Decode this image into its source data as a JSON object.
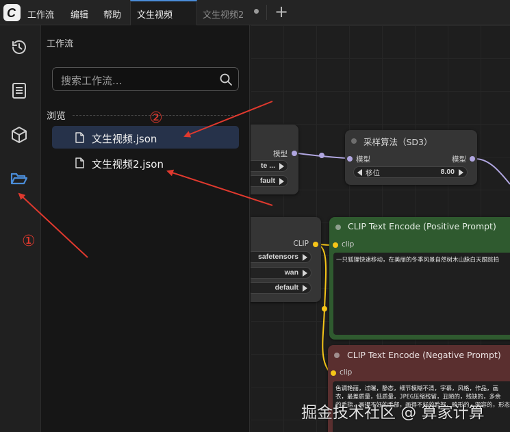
{
  "menu": {
    "logo_letter": "C",
    "items": [
      "工作流",
      "编辑",
      "帮助"
    ]
  },
  "tabs": [
    {
      "label": "文生视频",
      "active": true
    },
    {
      "label": "文生视频2",
      "active": false
    }
  ],
  "new_tab_symbol": "+",
  "rail": {
    "icons": [
      "history-icon",
      "queue-icon",
      "model-library-icon",
      "workflows-folder-icon"
    ],
    "active_icon": "workflows-folder-icon"
  },
  "workflow_panel": {
    "title": "工作流",
    "search_placeholder": "搜索工作流...",
    "section_label": "浏览",
    "items": [
      {
        "label": "文生视频.json",
        "selected": true
      },
      {
        "label": "文生视频2.json",
        "selected": false
      }
    ]
  },
  "canvas": {
    "node_partial_left": {
      "output_label": "模型",
      "fields": [
        "te ...",
        "fault"
      ]
    },
    "node_sampler": {
      "title": "采样算法（SD3）",
      "input_label": "模型",
      "output_label": "模型",
      "widget_label": "移位",
      "widget_value": "8.00"
    },
    "node_clip_loader": {
      "output_label": "CLIP",
      "fields": [
        "safetensors",
        "wan",
        "default"
      ]
    },
    "node_positive": {
      "title": "CLIP Text Encode (Positive Prompt)",
      "input_label": "clip",
      "text": "一只狐狸快速移动，在美丽的冬季风景自然树木山脉白天跟踪拍"
    },
    "node_negative": {
      "title": "CLIP Text Encode (Negative Prompt)",
      "input_label": "clip",
      "text_lines": [
        "色调艳丽，过曝，静态，细节模糊不清，字幕，风格，作品，画",
        "衣，最差质量，低质量，JPEG压缩残留，丑陋的，残缺的，多余",
        "的手指，画得不好的手部，画得不好的脸部，畸形的，毁容的，形态畸"
      ]
    },
    "colors": {
      "model_link": "#b0a6e0",
      "clip_link": "#f5c518",
      "positive_node": "#2f5a2f",
      "negative_node": "#5a2f2f"
    }
  },
  "annotations": {
    "marker_1": "①",
    "marker_2": "②",
    "arrow_color": "#e0392e"
  },
  "watermark": "掘金技术社区 @ 算家计算"
}
